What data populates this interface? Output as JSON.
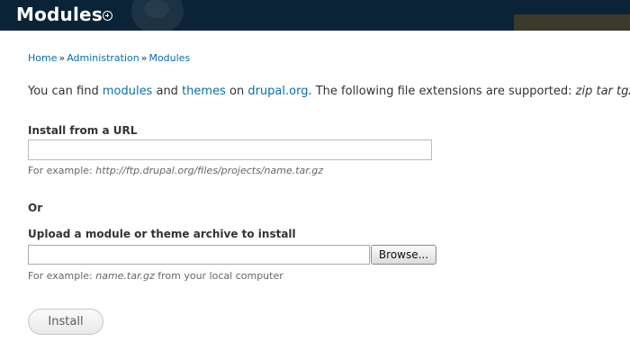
{
  "header": {
    "title": "Modules"
  },
  "breadcrumb": {
    "items": [
      "Home",
      "Administration",
      "Modules"
    ],
    "separator": "»"
  },
  "intro": {
    "text_1": "You can find ",
    "link_modules": "modules",
    "text_2": " and ",
    "link_themes": "themes",
    "text_3": " on ",
    "link_drupal": "drupal.org",
    "text_4": ". The following file extensions are supported: ",
    "extensions": "zip tar tgz g"
  },
  "install_url": {
    "label": "Install from a URL",
    "value": "",
    "description_prefix": "For example: ",
    "description_example": "http://ftp.drupal.org/files/projects/name.tar.gz"
  },
  "or_label": "Or",
  "upload": {
    "label": "Upload a module or theme archive to install",
    "browse_label": "Browse...",
    "description_prefix": "For example: ",
    "description_example": "name.tar.gz",
    "description_suffix": " from your local computer"
  },
  "install_button": "Install",
  "colors": {
    "header_bg": "#0a2337",
    "link": "#0b6ea8",
    "text": "#333333"
  }
}
